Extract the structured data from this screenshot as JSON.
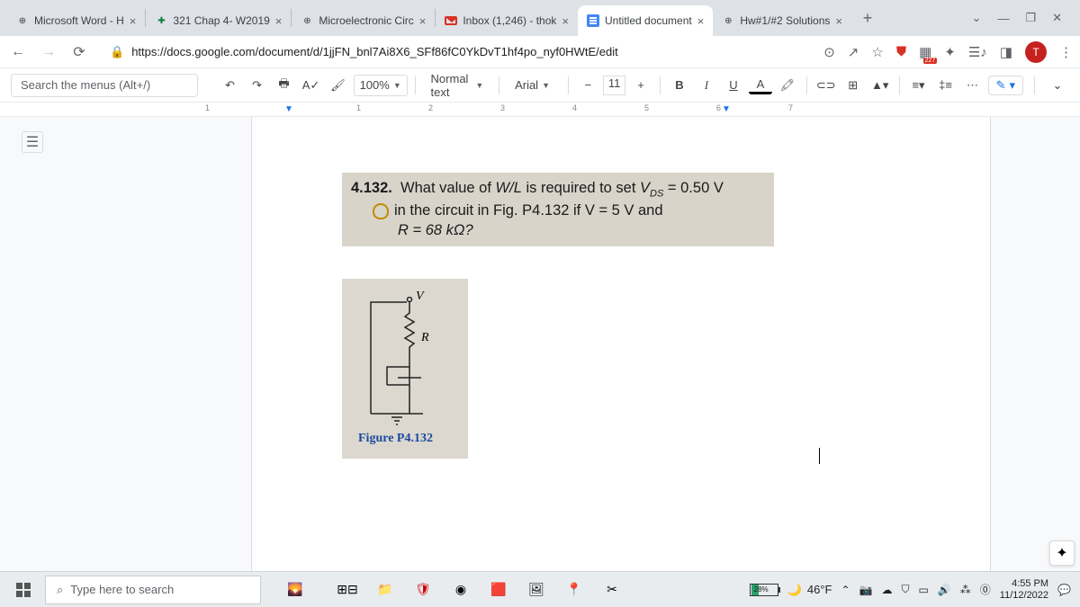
{
  "tabs": [
    {
      "title": "Microsoft Word - H",
      "icon": "⊕"
    },
    {
      "title": "321 Chap 4- W2019",
      "icon": "✳"
    },
    {
      "title": "Microelectronic Circ",
      "icon": "⊕"
    },
    {
      "title": "Inbox (1,246) - thok",
      "icon": "M"
    },
    {
      "title": "Untitled document",
      "icon": "docs",
      "active": true
    },
    {
      "title": "Hw#1/#2 Solutions",
      "icon": "⊕"
    }
  ],
  "addr": {
    "url": "https://docs.google.com/document/d/1jjFN_bnl7Ai8X6_SFf86fC0YkDvT1hf4po_nyf0HWtE/edit",
    "lock": "🔒"
  },
  "avatar_letter": "T",
  "docs": {
    "search_placeholder": "Search the menus (Alt+/)",
    "zoom": "100%",
    "style": "Normal text",
    "font": "Arial",
    "font_size": "11"
  },
  "ruler_nums": [
    "1",
    "1",
    "2",
    "3",
    "4",
    "5",
    "6",
    "7"
  ],
  "problem": {
    "number": "4.132.",
    "line1_a": "What value of ",
    "line1_b": "W/L",
    "line1_c": " is required to set ",
    "line1_d": "V",
    "line1_sub": "DS",
    "line1_e": " = 0.50 V",
    "line2": "in the circuit in Fig. P4.132 if V = 5 V and",
    "line3": "R = 68 kΩ?"
  },
  "figure": {
    "v_label": "V",
    "r_label": "R",
    "caption": "Figure P4.132"
  },
  "taskbar": {
    "search_placeholder": "Type here to search",
    "battery": "28%",
    "temp": "46°F",
    "time": "4:55 PM",
    "date": "11/12/2022"
  }
}
